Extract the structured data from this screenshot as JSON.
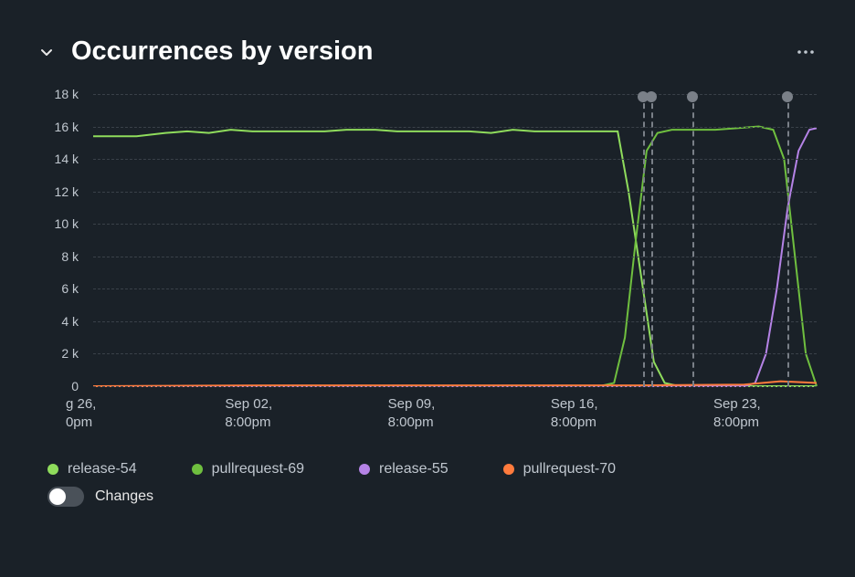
{
  "header": {
    "title": "Occurrences by version"
  },
  "chart_data": {
    "type": "line",
    "title": "Occurrences by version",
    "xlabel": "",
    "ylabel": "",
    "ylim": [
      0,
      18000
    ],
    "y_ticks": [
      "18 k",
      "16 k",
      "14 k",
      "12 k",
      "10 k",
      "8 k",
      "6 k",
      "4 k",
      "2 k",
      "0"
    ],
    "x_ticks": [
      {
        "pos": 0.0,
        "line1": "g 26,",
        "line2": "0pm"
      },
      {
        "pos": 0.215,
        "line1": "Sep 02,",
        "line2": "8:00pm"
      },
      {
        "pos": 0.44,
        "line1": "Sep 09,",
        "line2": "8:00pm"
      },
      {
        "pos": 0.665,
        "line1": "Sep 16,",
        "line2": "8:00pm"
      },
      {
        "pos": 0.89,
        "line1": "Sep 23,",
        "line2": "8:00pm"
      }
    ],
    "event_markers": [
      0.76,
      0.772,
      0.828,
      0.96
    ],
    "series": [
      {
        "name": "release-54",
        "color": "#8fdc5c",
        "points": [
          [
            0.0,
            15400
          ],
          [
            0.03,
            15400
          ],
          [
            0.06,
            15400
          ],
          [
            0.1,
            15600
          ],
          [
            0.13,
            15700
          ],
          [
            0.16,
            15600
          ],
          [
            0.19,
            15800
          ],
          [
            0.22,
            15700
          ],
          [
            0.26,
            15700
          ],
          [
            0.29,
            15700
          ],
          [
            0.32,
            15700
          ],
          [
            0.35,
            15800
          ],
          [
            0.39,
            15800
          ],
          [
            0.42,
            15700
          ],
          [
            0.45,
            15700
          ],
          [
            0.48,
            15700
          ],
          [
            0.52,
            15700
          ],
          [
            0.55,
            15600
          ],
          [
            0.58,
            15800
          ],
          [
            0.61,
            15700
          ],
          [
            0.65,
            15700
          ],
          [
            0.68,
            15700
          ],
          [
            0.71,
            15700
          ],
          [
            0.725,
            15700
          ],
          [
            0.74,
            12000
          ],
          [
            0.76,
            6000
          ],
          [
            0.775,
            1500
          ],
          [
            0.79,
            200
          ],
          [
            0.81,
            0
          ],
          [
            1.0,
            0
          ]
        ]
      },
      {
        "name": "pullrequest-69",
        "color": "#6fbf3f",
        "points": [
          [
            0.0,
            0
          ],
          [
            0.7,
            0
          ],
          [
            0.72,
            200
          ],
          [
            0.735,
            3000
          ],
          [
            0.75,
            9000
          ],
          [
            0.765,
            14500
          ],
          [
            0.78,
            15600
          ],
          [
            0.8,
            15800
          ],
          [
            0.83,
            15800
          ],
          [
            0.86,
            15800
          ],
          [
            0.89,
            15900
          ],
          [
            0.92,
            16000
          ],
          [
            0.94,
            15800
          ],
          [
            0.955,
            14000
          ],
          [
            0.97,
            8000
          ],
          [
            0.985,
            2000
          ],
          [
            1.0,
            0
          ]
        ]
      },
      {
        "name": "release-55",
        "color": "#b583e6",
        "points": [
          [
            0.0,
            0
          ],
          [
            0.9,
            0
          ],
          [
            0.915,
            200
          ],
          [
            0.93,
            2000
          ],
          [
            0.945,
            6000
          ],
          [
            0.96,
            11000
          ],
          [
            0.975,
            14500
          ],
          [
            0.99,
            15800
          ],
          [
            1.0,
            15900
          ]
        ]
      },
      {
        "name": "pullrequest-70",
        "color": "#ff7b3d",
        "points": [
          [
            0.0,
            0
          ],
          [
            0.25,
            50
          ],
          [
            0.5,
            50
          ],
          [
            0.75,
            50
          ],
          [
            0.9,
            100
          ],
          [
            0.95,
            300
          ],
          [
            1.0,
            200
          ]
        ]
      }
    ]
  },
  "legend": [
    {
      "label": "release-54",
      "color": "#8fdc5c"
    },
    {
      "label": "pullrequest-69",
      "color": "#6fbf3f"
    },
    {
      "label": "release-55",
      "color": "#b583e6"
    },
    {
      "label": "pullrequest-70",
      "color": "#ff7b3d"
    }
  ],
  "toggle": {
    "label": "Changes",
    "on": false
  }
}
